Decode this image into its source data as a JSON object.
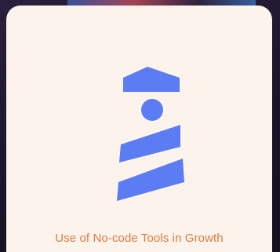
{
  "card": {
    "title": "Use of No-code Tools in Growth",
    "icon": "lighthouse-icon"
  },
  "colors": {
    "card_background": "#fcf4ec",
    "accent": "#5b7cf2",
    "title": "#e07a3c"
  }
}
